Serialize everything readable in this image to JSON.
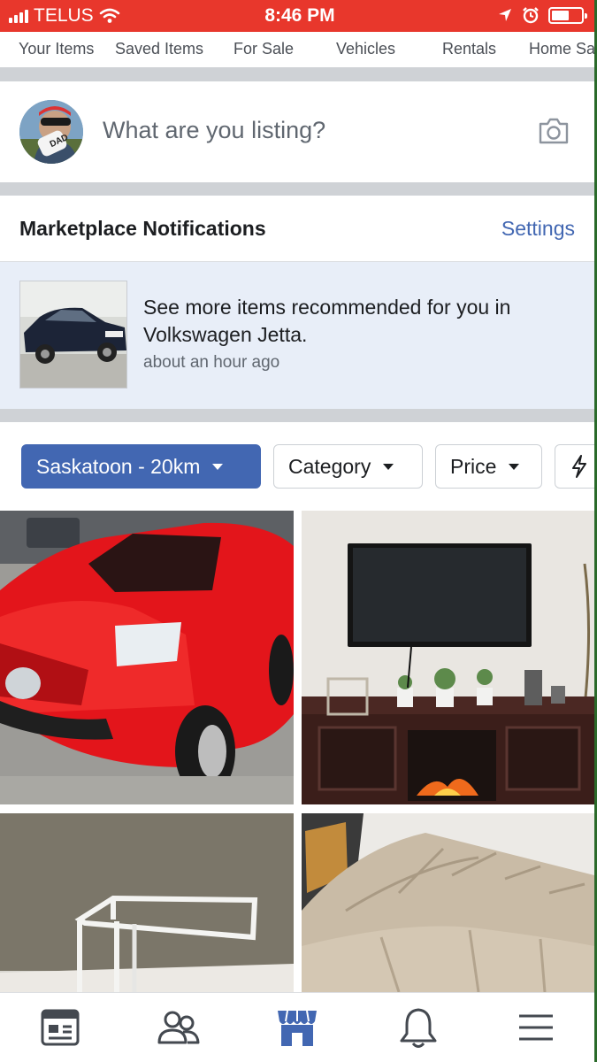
{
  "status_bar": {
    "carrier": "TELUS",
    "time": "8:46 PM",
    "battery_level": 0.6
  },
  "tabs": [
    "Your Items",
    "Saved Items",
    "For Sale",
    "Vehicles",
    "Rentals",
    "Home Sa"
  ],
  "composer": {
    "placeholder": "What are you listing?",
    "avatar_badge": "DAD",
    "camera_icon": "camera-icon"
  },
  "notifications": {
    "title": "Marketplace Notifications",
    "settings_label": "Settings",
    "item": {
      "text": "See more items recommended for you in Volkswagen Jetta.",
      "time": "about an hour ago"
    }
  },
  "filters": {
    "location": "Saskatoon - 20km",
    "category": "Category",
    "price": "Price",
    "extra_icon": "lightning-icon"
  },
  "listings": [
    {
      "photo": "red-toy-car-photo"
    },
    {
      "photo": "tv-fireplace-stand-photo"
    },
    {
      "photo": "glass-side-table-photo"
    },
    {
      "photo": "beige-futon-photo"
    }
  ],
  "bottom_nav": [
    {
      "icon": "news-feed-icon"
    },
    {
      "icon": "friends-icon"
    },
    {
      "icon": "marketplace-icon",
      "active": true
    },
    {
      "icon": "notifications-icon"
    },
    {
      "icon": "menu-icon"
    }
  ],
  "colors": {
    "status_bar": "#e8372c",
    "accent": "#4267b2",
    "notification_bg": "#e8eef8",
    "divider": "#cfd2d6"
  }
}
